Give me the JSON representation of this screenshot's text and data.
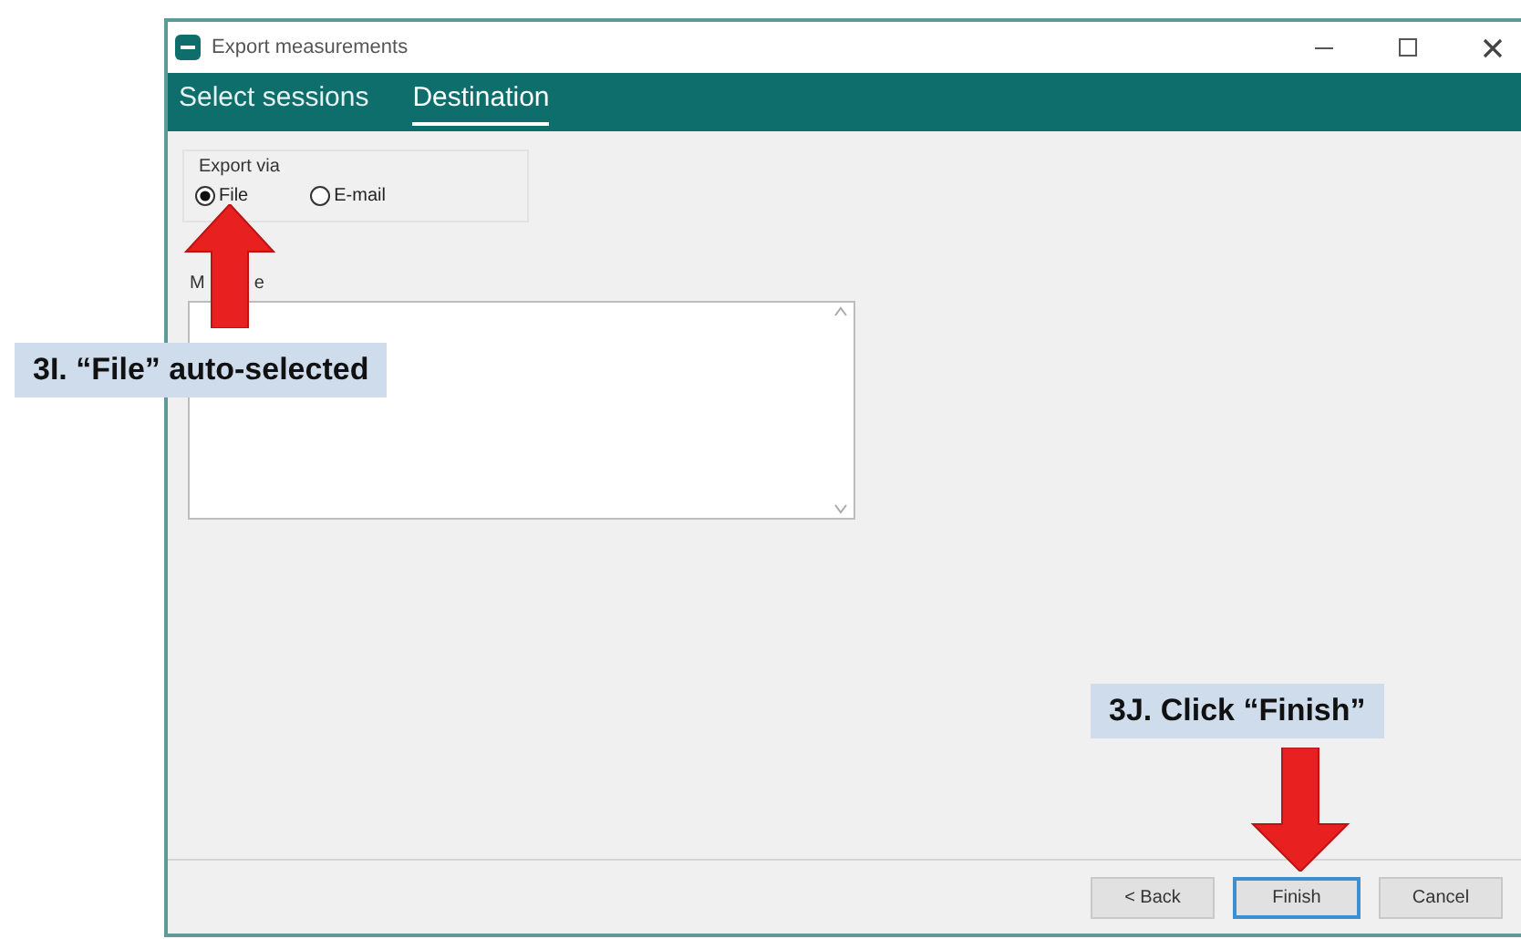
{
  "window": {
    "title": "Export measurements"
  },
  "tabs": [
    {
      "label": "Select sessions",
      "selected": false
    },
    {
      "label": "Destination",
      "selected": true
    }
  ],
  "export_via": {
    "label": "Export via",
    "options": [
      {
        "label": "File",
        "selected": true
      },
      {
        "label": "E-mail",
        "selected": false
      }
    ]
  },
  "message": {
    "label_parts": [
      "M",
      "e"
    ]
  },
  "buttons": [
    {
      "label": "< Back",
      "default": false
    },
    {
      "label": "Finish",
      "default": true
    },
    {
      "label": "Cancel",
      "default": false
    }
  ],
  "annotations": [
    {
      "text": "3I. “File” auto-selected",
      "kind": "up"
    },
    {
      "text": "3J. Click “Finish”",
      "kind": "down"
    }
  ]
}
